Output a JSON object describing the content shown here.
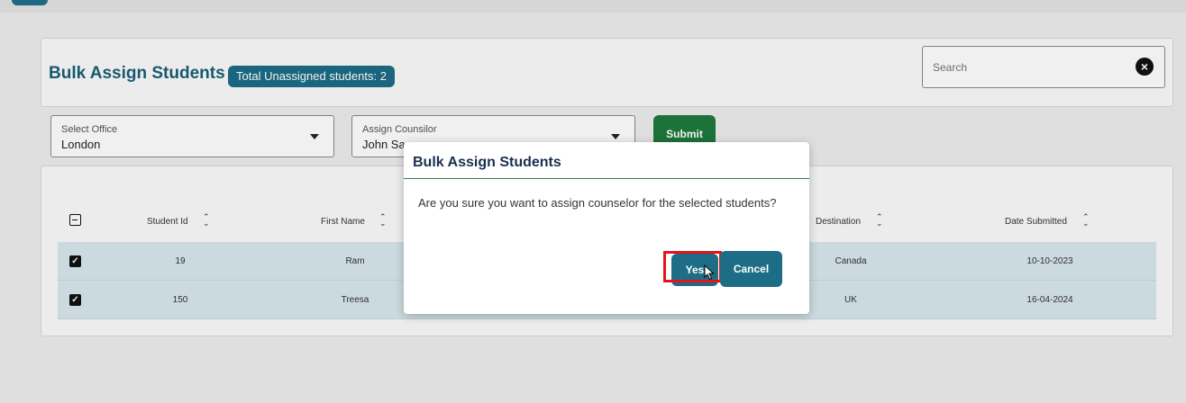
{
  "header": {
    "title": "Bulk Assign Students",
    "badge": "Total Unassigned students: 2",
    "search_placeholder": "Search"
  },
  "filters": {
    "office_label": "Select Office",
    "office_value": "London",
    "counselor_label": "Assign Counsilor",
    "counselor_value": "John Sa",
    "submit_label": "Submit"
  },
  "table": {
    "columns": [
      "Student Id",
      "First Name",
      "Destination",
      "Date Submitted"
    ],
    "rows": [
      {
        "checked": true,
        "student_id": "19",
        "first_name": "Ram",
        "destination": "Canada",
        "date_submitted": "10-10-2023"
      },
      {
        "checked": true,
        "student_id": "150",
        "first_name": "Treesa",
        "destination": "UK",
        "date_submitted": "16-04-2024"
      }
    ]
  },
  "modal": {
    "title": "Bulk Assign Students",
    "message": "Are you sure you want to assign counselor for the selected students?",
    "yes_label": "Yes",
    "cancel_label": "Cancel"
  },
  "colors": {
    "primary": "#1d6d87",
    "submit_green": "#1e7a3d",
    "row_highlight": "#d8e8ec",
    "highlight_box": "#e3151c"
  },
  "icons": {
    "clear": "close-circle-icon",
    "sort": "sort-arrows-icon",
    "dropdown": "chevron-down-icon",
    "cursor": "pointer-cursor-icon"
  }
}
